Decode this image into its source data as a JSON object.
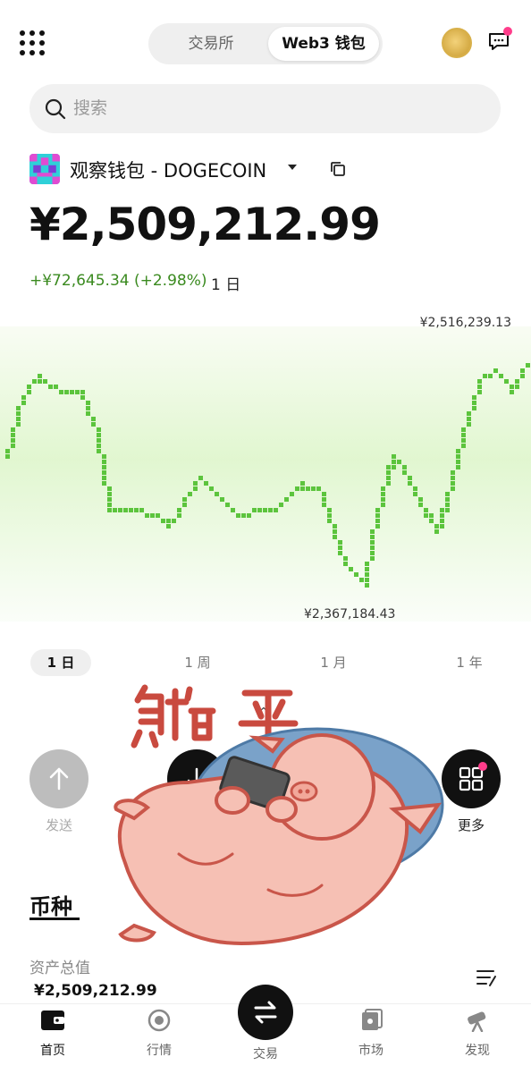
{
  "header": {
    "tabs": [
      {
        "label": "交易所",
        "active": false
      },
      {
        "label": "Web3 钱包",
        "active": true
      }
    ],
    "notification_dot_color": "#ff3d8b"
  },
  "search": {
    "placeholder": "搜索"
  },
  "wallet": {
    "name": "观察钱包 - DOGECOIN",
    "balance": "¥2,509,212.99",
    "change": "+¥72,645.34 (+2.98%)",
    "change_period": "1 日",
    "change_color": "#3a8a1f"
  },
  "chart_data": {
    "type": "line",
    "high_label": "¥2,516,239.13",
    "low_label": "¥2,367,184.43",
    "y_min": 2367184.43,
    "y_max": 2516239.13,
    "series_color": "#5cc43d",
    "values": [
      2455000,
      2490000,
      2505000,
      2500000,
      2495000,
      2495000,
      2470000,
      2420000,
      2418000,
      2418000,
      2415000,
      2410000,
      2425000,
      2440000,
      2430000,
      2420000,
      2415000,
      2420000,
      2420000,
      2430000,
      2435000,
      2432000,
      2405000,
      2380000,
      2372000,
      2420000,
      2455000,
      2440000,
      2420000,
      2405000,
      2440000,
      2478000,
      2505000,
      2510000,
      2495000,
      2516000
    ]
  },
  "periods": [
    {
      "label": "1 日",
      "active": true
    },
    {
      "label": "1 周",
      "active": false
    },
    {
      "label": "1 月",
      "active": false
    },
    {
      "label": "1 年",
      "active": false
    }
  ],
  "actions": {
    "send_label": "发送",
    "more_label": "更多"
  },
  "tokens": {
    "title": "币种",
    "total_label": "资产总值",
    "total_value": "¥2,509,212.99"
  },
  "sticker": {
    "text": "躺平",
    "icon": "lying-pig-sticker"
  },
  "nav": {
    "home": "首页",
    "market": "行情",
    "trade": "交易",
    "marketplace": "市场",
    "discover": "发现"
  }
}
